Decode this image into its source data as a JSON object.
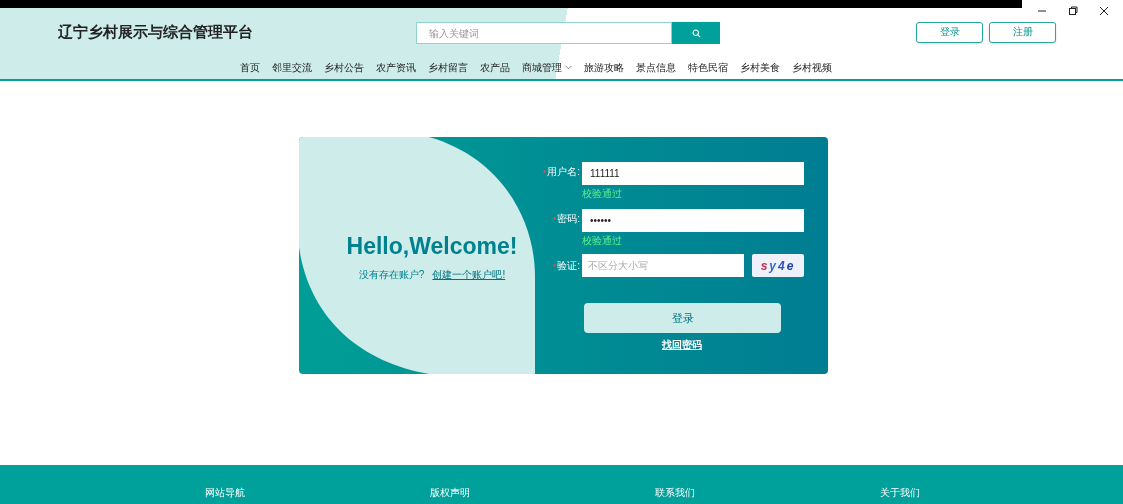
{
  "site": {
    "title": "辽宁乡村展示与综合管理平台"
  },
  "search": {
    "placeholder": "输入关键词"
  },
  "auth_buttons": [
    "登录",
    "注册"
  ],
  "nav": [
    {
      "label": "首页",
      "kind": "link"
    },
    {
      "label": "邻里交流",
      "kind": "link"
    },
    {
      "label": "乡村公告",
      "kind": "link"
    },
    {
      "label": "农产资讯",
      "kind": "link"
    },
    {
      "label": "乡村留言",
      "kind": "link"
    },
    {
      "label": "农产品",
      "kind": "link"
    },
    {
      "label": "商城管理",
      "kind": "dropdown"
    },
    {
      "label": "旅游攻略",
      "kind": "link"
    },
    {
      "label": "景点信息",
      "kind": "link"
    },
    {
      "label": "特色民宿",
      "kind": "link"
    },
    {
      "label": "乡村美食",
      "kind": "link"
    },
    {
      "label": "乡村视频",
      "kind": "link"
    }
  ],
  "welcome": {
    "heading": "Hello,Welcome!",
    "prompt": "没有存在账户?",
    "link": "创建一个账户吧!"
  },
  "form": {
    "fields": [
      {
        "label": "用户名:",
        "value": "111111",
        "hint": "校验通过",
        "kind": "text"
      },
      {
        "label": "密码:",
        "value": "••••••",
        "hint": "校验通过",
        "kind": "text"
      },
      {
        "label": "验证:",
        "placeholder": "不区分大小写",
        "captcha": "sy4e",
        "kind": "captcha"
      }
    ],
    "submit": "登录",
    "forgot": "找回密码"
  },
  "footer": [
    "网站导航",
    "版权声明",
    "联系我们",
    "关于我们"
  ]
}
